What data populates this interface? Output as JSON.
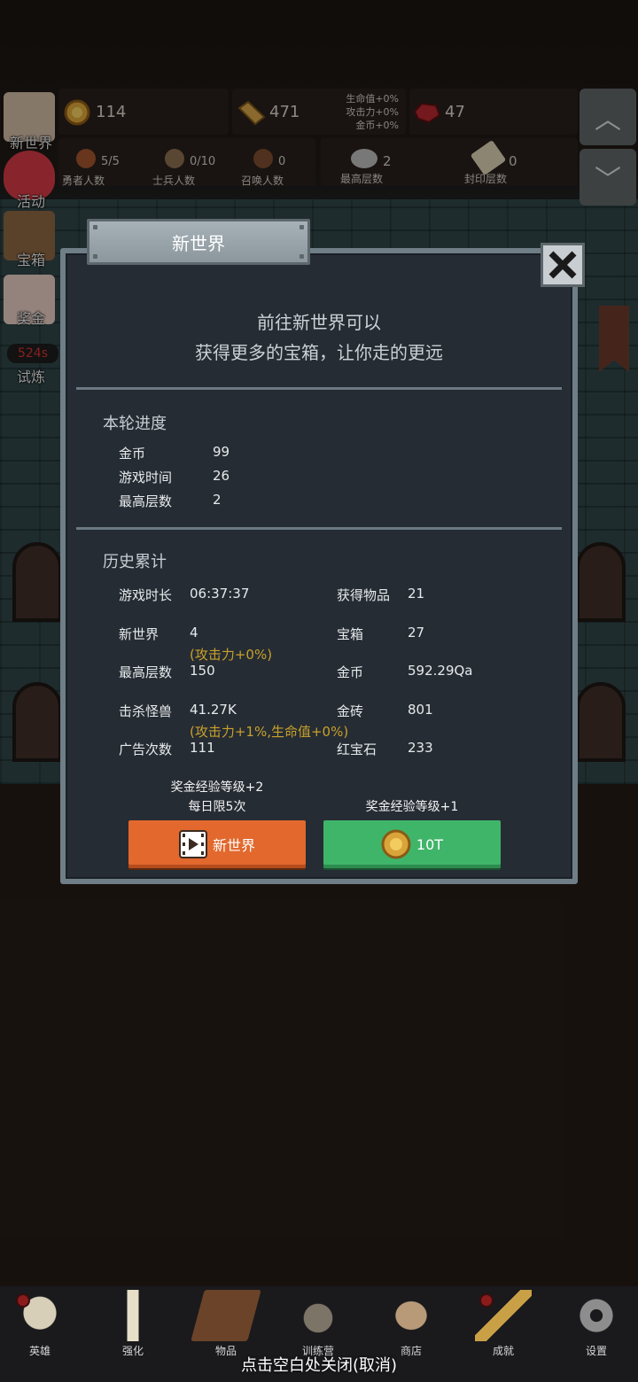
{
  "resources": {
    "gold": "114",
    "gold_bars": "471",
    "bonus_lines": [
      "生命值+0%",
      "攻击力+0%",
      "金币+0%"
    ],
    "rubies": "47"
  },
  "counts": {
    "heroes": {
      "value": "5/5",
      "label": "勇者人数"
    },
    "soldiers": {
      "value": "0/10",
      "label": "士兵人数"
    },
    "summons": {
      "value": "0",
      "label": "召唤人数"
    },
    "max_floor": {
      "value": "2",
      "label": "最高层数"
    },
    "sealed_floor": {
      "value": "0",
      "label": "封印层数"
    }
  },
  "side_menu": {
    "new_world": "新世界",
    "events": "活动",
    "chest": "宝箱",
    "bonus": "奖金",
    "timer": "524s",
    "trial": "试炼"
  },
  "dialog": {
    "title": "新世界",
    "intro_line1": "前往新世界可以",
    "intro_line2": "获得更多的宝箱，让你走的更远",
    "round_title": "本轮进度",
    "round": [
      {
        "label": "金币",
        "value": "99"
      },
      {
        "label": "游戏时间",
        "value": "26"
      },
      {
        "label": "最高层数",
        "value": "2"
      }
    ],
    "history_title": "历史累计",
    "history_left": [
      {
        "label": "游戏时长",
        "value": "06:37:37"
      },
      {
        "label": "新世界",
        "value": "4"
      },
      {
        "label": "最高层数",
        "value": "150"
      },
      {
        "label": "击杀怪兽",
        "value": "41.27K"
      },
      {
        "label": "广告次数",
        "value": "111"
      }
    ],
    "history_right": [
      {
        "label": "获得物品",
        "value": "21"
      },
      {
        "label": "宝箱",
        "value": "27"
      },
      {
        "label": "金币",
        "value": "592.29Qa"
      },
      {
        "label": "金砖",
        "value": "801"
      },
      {
        "label": "红宝石",
        "value": "233"
      }
    ],
    "bonus_new_world": "(攻击力+0%)",
    "bonus_kills": "(攻击力+1%,生命值+0%)",
    "ad_caption_line1": "奖金经验等级+2",
    "ad_caption_line2": "每日限5次",
    "ad_button": "新世界",
    "gold_caption": "奖金经验等级+1",
    "gold_button": "10T"
  },
  "bottom_nav": [
    "英雄",
    "强化",
    "物品",
    "训练营",
    "商店",
    "成就",
    "设置"
  ],
  "close_hint": "点击空白处关闭(取消)",
  "colors": {
    "accent_orange": "#e2682d",
    "accent_green": "#3fb56a",
    "bonus_gold": "#c8a12a",
    "dialog_bg": "#262c34"
  }
}
